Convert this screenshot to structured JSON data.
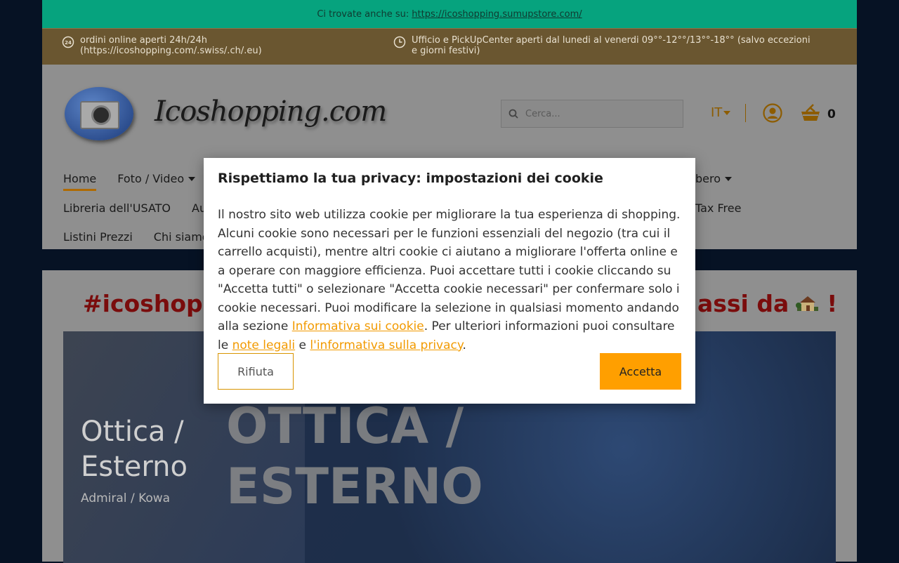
{
  "promo": {
    "text": "Ci trovate anche su:",
    "link": "https://icoshopping.sumupstore.com/"
  },
  "info": {
    "left": "ordini online aperti 24h/24h (https://icoshopping.com/.swiss/.ch/.eu)",
    "right": "Ufficio e PickUpCenter aperti dal lunedi al venerdi 09°°-12°°/13°°-18°° (salvo eccezioni e giorni festivi)",
    "left_icon": "24h-clock-icon",
    "right_icon": "clock-icon"
  },
  "header": {
    "logo_text": "Icoshopping.com",
    "search_placeholder": "Cerca...",
    "language": "IT",
    "cart_count": "0"
  },
  "nav": {
    "row1": [
      {
        "label": "Home",
        "active": true
      },
      {
        "label": "Foto / Video",
        "dropdown": true
      }
    ],
    "row1_right": {
      "label": "bero",
      "dropdown": true
    },
    "row2": [
      {
        "label": "Libreria dell'USATO"
      },
      {
        "label": "Au"
      }
    ],
    "row2_right": {
      "label": "Tax Free"
    },
    "row3": [
      {
        "label": "Listini Prezzi"
      },
      {
        "label": "Chi siamo"
      }
    ]
  },
  "content": {
    "headline_left": "#icoshoppi",
    "headline_right": "assi da",
    "headline_end": "!",
    "banner_title": "Ottica / Esterno",
    "banner_subtitle": "Admiral / Kowa",
    "banner_ghost_line1": "OTTICA /",
    "banner_ghost_line2": "ESTERNO"
  },
  "cookie": {
    "title": "Rispettiamo la tua privacy: impostazioni dei cookie",
    "text_1": "Il nostro sito web utilizza cookie per migliorare la tua esperienza di shopping. Alcuni cookie sono necessari per le funzioni essenziali del negozio (tra cui il carrello acquisti), mentre altri cookie ci aiutano a migliorare l'offerta online e a operare con maggiore efficienza. Puoi accettare tutti i cookie cliccando su \"Accetta tutti\" o selezionare \"Accetta cookie necessari\" per confermare solo i cookie necessari. Puoi modificare la selezione in qualsiasi momento andando alla sezione ",
    "link_cookie": "Informativa sui cookie",
    "text_2": ". Per ulteriori informazioni puoi consultare le ",
    "link_legal": "note legali",
    "text_3": " e ",
    "link_privacy": "l'informativa sulla privacy",
    "text_4": ".",
    "reject": "Rifiuta",
    "accept": "Accetta"
  },
  "colors": {
    "promo_bg": "#06a37e",
    "infobar_bg": "#6a5630",
    "accent": "#ff9f00",
    "headline": "#c40f0f"
  }
}
